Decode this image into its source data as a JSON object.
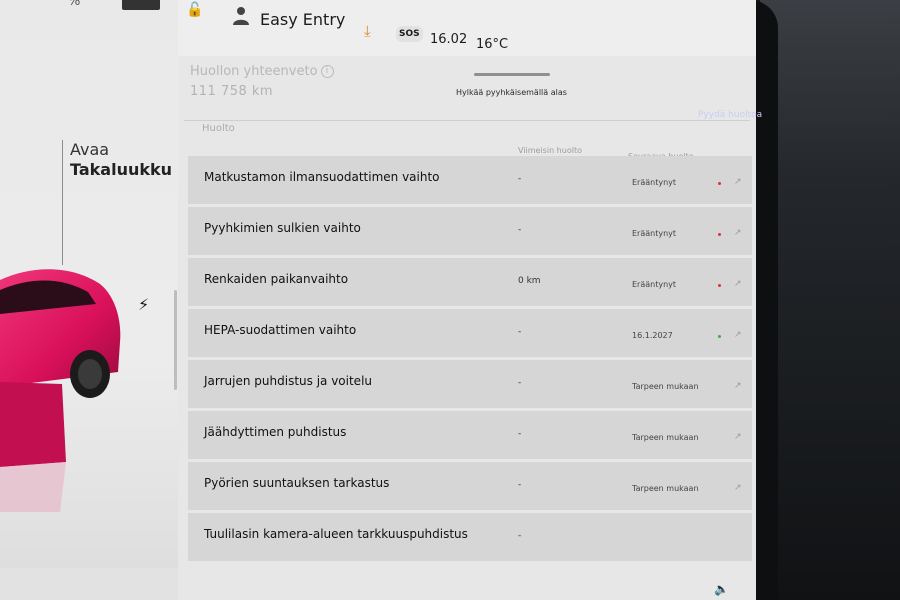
{
  "left_panel": {
    "top_text": "%",
    "trunk_label_line1": "Avaa",
    "trunk_label_line2": "Takaluukku",
    "bolt_icon": "lightning-bolt-icon",
    "car_color": "#e0135d"
  },
  "status_bar": {
    "lock_icon": "unlocked-padlock-icon",
    "person_icon": "person-icon",
    "profile": "Easy Entry",
    "download_icon": "download-icon",
    "sos": "SOS",
    "time": "16.02",
    "temperature": "16°C"
  },
  "summary": {
    "title": "Huollon yhteenveto",
    "odometer": "111 758  km",
    "swipe_hint": "Hylkää pyyhkäisemällä alas",
    "link": "Pyydä huoltoa"
  },
  "table": {
    "title": "Huolto",
    "col_last": "Viimeisin huolto",
    "col_next": "Seuraava huolto",
    "rows": [
      {
        "name": "Matkustamon ilmansuodattimen vaihto",
        "last": "-",
        "next": "Erääntynyt",
        "dot": "red"
      },
      {
        "name": "Pyyhkimien sulkien vaihto",
        "last": "-",
        "next": "Erääntynyt",
        "dot": "red"
      },
      {
        "name": "Renkaiden paikanvaihto",
        "last": "0 km",
        "next": "Erääntynyt",
        "dot": "red"
      },
      {
        "name": "HEPA-suodattimen vaihto",
        "last": "-",
        "next": "16.1.2027",
        "dot": "green"
      },
      {
        "name": "Jarrujen puhdistus ja voitelu",
        "last": "-",
        "next": "Tarpeen mukaan",
        "dot": ""
      },
      {
        "name": "Jäähdyttimen puhdistus",
        "last": "-",
        "next": "Tarpeen mukaan",
        "dot": ""
      },
      {
        "name": "Pyörien suuntauksen tarkastus",
        "last": "-",
        "next": "Tarpeen mukaan",
        "dot": ""
      },
      {
        "name": "Tuulilasin kamera-alueen tarkkuuspuhdistus",
        "last": "-",
        "next": "",
        "dot": ""
      }
    ]
  },
  "colors": {
    "accent_orange": "#e08a2a",
    "status_red": "#d8373a",
    "status_green": "#3cae4f",
    "link_blue": "#c9cdf2"
  }
}
